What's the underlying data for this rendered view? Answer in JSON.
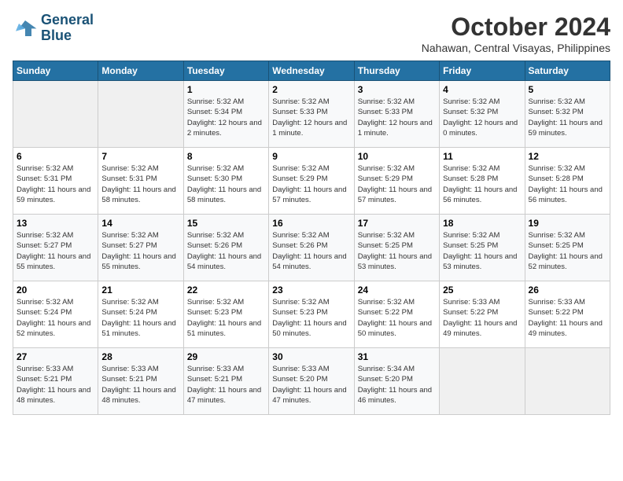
{
  "logo": {
    "line1": "General",
    "line2": "Blue"
  },
  "title": {
    "month_year": "October 2024",
    "location": "Nahawan, Central Visayas, Philippines"
  },
  "weekdays": [
    "Sunday",
    "Monday",
    "Tuesday",
    "Wednesday",
    "Thursday",
    "Friday",
    "Saturday"
  ],
  "weeks": [
    [
      {
        "day": null
      },
      {
        "day": null
      },
      {
        "day": 1,
        "sunrise": "Sunrise: 5:32 AM",
        "sunset": "Sunset: 5:34 PM",
        "daylight": "Daylight: 12 hours and 2 minutes."
      },
      {
        "day": 2,
        "sunrise": "Sunrise: 5:32 AM",
        "sunset": "Sunset: 5:33 PM",
        "daylight": "Daylight: 12 hours and 1 minute."
      },
      {
        "day": 3,
        "sunrise": "Sunrise: 5:32 AM",
        "sunset": "Sunset: 5:33 PM",
        "daylight": "Daylight: 12 hours and 1 minute."
      },
      {
        "day": 4,
        "sunrise": "Sunrise: 5:32 AM",
        "sunset": "Sunset: 5:32 PM",
        "daylight": "Daylight: 12 hours and 0 minutes."
      },
      {
        "day": 5,
        "sunrise": "Sunrise: 5:32 AM",
        "sunset": "Sunset: 5:32 PM",
        "daylight": "Daylight: 11 hours and 59 minutes."
      }
    ],
    [
      {
        "day": 6,
        "sunrise": "Sunrise: 5:32 AM",
        "sunset": "Sunset: 5:31 PM",
        "daylight": "Daylight: 11 hours and 59 minutes."
      },
      {
        "day": 7,
        "sunrise": "Sunrise: 5:32 AM",
        "sunset": "Sunset: 5:31 PM",
        "daylight": "Daylight: 11 hours and 58 minutes."
      },
      {
        "day": 8,
        "sunrise": "Sunrise: 5:32 AM",
        "sunset": "Sunset: 5:30 PM",
        "daylight": "Daylight: 11 hours and 58 minutes."
      },
      {
        "day": 9,
        "sunrise": "Sunrise: 5:32 AM",
        "sunset": "Sunset: 5:29 PM",
        "daylight": "Daylight: 11 hours and 57 minutes."
      },
      {
        "day": 10,
        "sunrise": "Sunrise: 5:32 AM",
        "sunset": "Sunset: 5:29 PM",
        "daylight": "Daylight: 11 hours and 57 minutes."
      },
      {
        "day": 11,
        "sunrise": "Sunrise: 5:32 AM",
        "sunset": "Sunset: 5:28 PM",
        "daylight": "Daylight: 11 hours and 56 minutes."
      },
      {
        "day": 12,
        "sunrise": "Sunrise: 5:32 AM",
        "sunset": "Sunset: 5:28 PM",
        "daylight": "Daylight: 11 hours and 56 minutes."
      }
    ],
    [
      {
        "day": 13,
        "sunrise": "Sunrise: 5:32 AM",
        "sunset": "Sunset: 5:27 PM",
        "daylight": "Daylight: 11 hours and 55 minutes."
      },
      {
        "day": 14,
        "sunrise": "Sunrise: 5:32 AM",
        "sunset": "Sunset: 5:27 PM",
        "daylight": "Daylight: 11 hours and 55 minutes."
      },
      {
        "day": 15,
        "sunrise": "Sunrise: 5:32 AM",
        "sunset": "Sunset: 5:26 PM",
        "daylight": "Daylight: 11 hours and 54 minutes."
      },
      {
        "day": 16,
        "sunrise": "Sunrise: 5:32 AM",
        "sunset": "Sunset: 5:26 PM",
        "daylight": "Daylight: 11 hours and 54 minutes."
      },
      {
        "day": 17,
        "sunrise": "Sunrise: 5:32 AM",
        "sunset": "Sunset: 5:25 PM",
        "daylight": "Daylight: 11 hours and 53 minutes."
      },
      {
        "day": 18,
        "sunrise": "Sunrise: 5:32 AM",
        "sunset": "Sunset: 5:25 PM",
        "daylight": "Daylight: 11 hours and 53 minutes."
      },
      {
        "day": 19,
        "sunrise": "Sunrise: 5:32 AM",
        "sunset": "Sunset: 5:25 PM",
        "daylight": "Daylight: 11 hours and 52 minutes."
      }
    ],
    [
      {
        "day": 20,
        "sunrise": "Sunrise: 5:32 AM",
        "sunset": "Sunset: 5:24 PM",
        "daylight": "Daylight: 11 hours and 52 minutes."
      },
      {
        "day": 21,
        "sunrise": "Sunrise: 5:32 AM",
        "sunset": "Sunset: 5:24 PM",
        "daylight": "Daylight: 11 hours and 51 minutes."
      },
      {
        "day": 22,
        "sunrise": "Sunrise: 5:32 AM",
        "sunset": "Sunset: 5:23 PM",
        "daylight": "Daylight: 11 hours and 51 minutes."
      },
      {
        "day": 23,
        "sunrise": "Sunrise: 5:32 AM",
        "sunset": "Sunset: 5:23 PM",
        "daylight": "Daylight: 11 hours and 50 minutes."
      },
      {
        "day": 24,
        "sunrise": "Sunrise: 5:32 AM",
        "sunset": "Sunset: 5:22 PM",
        "daylight": "Daylight: 11 hours and 50 minutes."
      },
      {
        "day": 25,
        "sunrise": "Sunrise: 5:33 AM",
        "sunset": "Sunset: 5:22 PM",
        "daylight": "Daylight: 11 hours and 49 minutes."
      },
      {
        "day": 26,
        "sunrise": "Sunrise: 5:33 AM",
        "sunset": "Sunset: 5:22 PM",
        "daylight": "Daylight: 11 hours and 49 minutes."
      }
    ],
    [
      {
        "day": 27,
        "sunrise": "Sunrise: 5:33 AM",
        "sunset": "Sunset: 5:21 PM",
        "daylight": "Daylight: 11 hours and 48 minutes."
      },
      {
        "day": 28,
        "sunrise": "Sunrise: 5:33 AM",
        "sunset": "Sunset: 5:21 PM",
        "daylight": "Daylight: 11 hours and 48 minutes."
      },
      {
        "day": 29,
        "sunrise": "Sunrise: 5:33 AM",
        "sunset": "Sunset: 5:21 PM",
        "daylight": "Daylight: 11 hours and 47 minutes."
      },
      {
        "day": 30,
        "sunrise": "Sunrise: 5:33 AM",
        "sunset": "Sunset: 5:20 PM",
        "daylight": "Daylight: 11 hours and 47 minutes."
      },
      {
        "day": 31,
        "sunrise": "Sunrise: 5:34 AM",
        "sunset": "Sunset: 5:20 PM",
        "daylight": "Daylight: 11 hours and 46 minutes."
      },
      {
        "day": null
      },
      {
        "day": null
      }
    ]
  ]
}
